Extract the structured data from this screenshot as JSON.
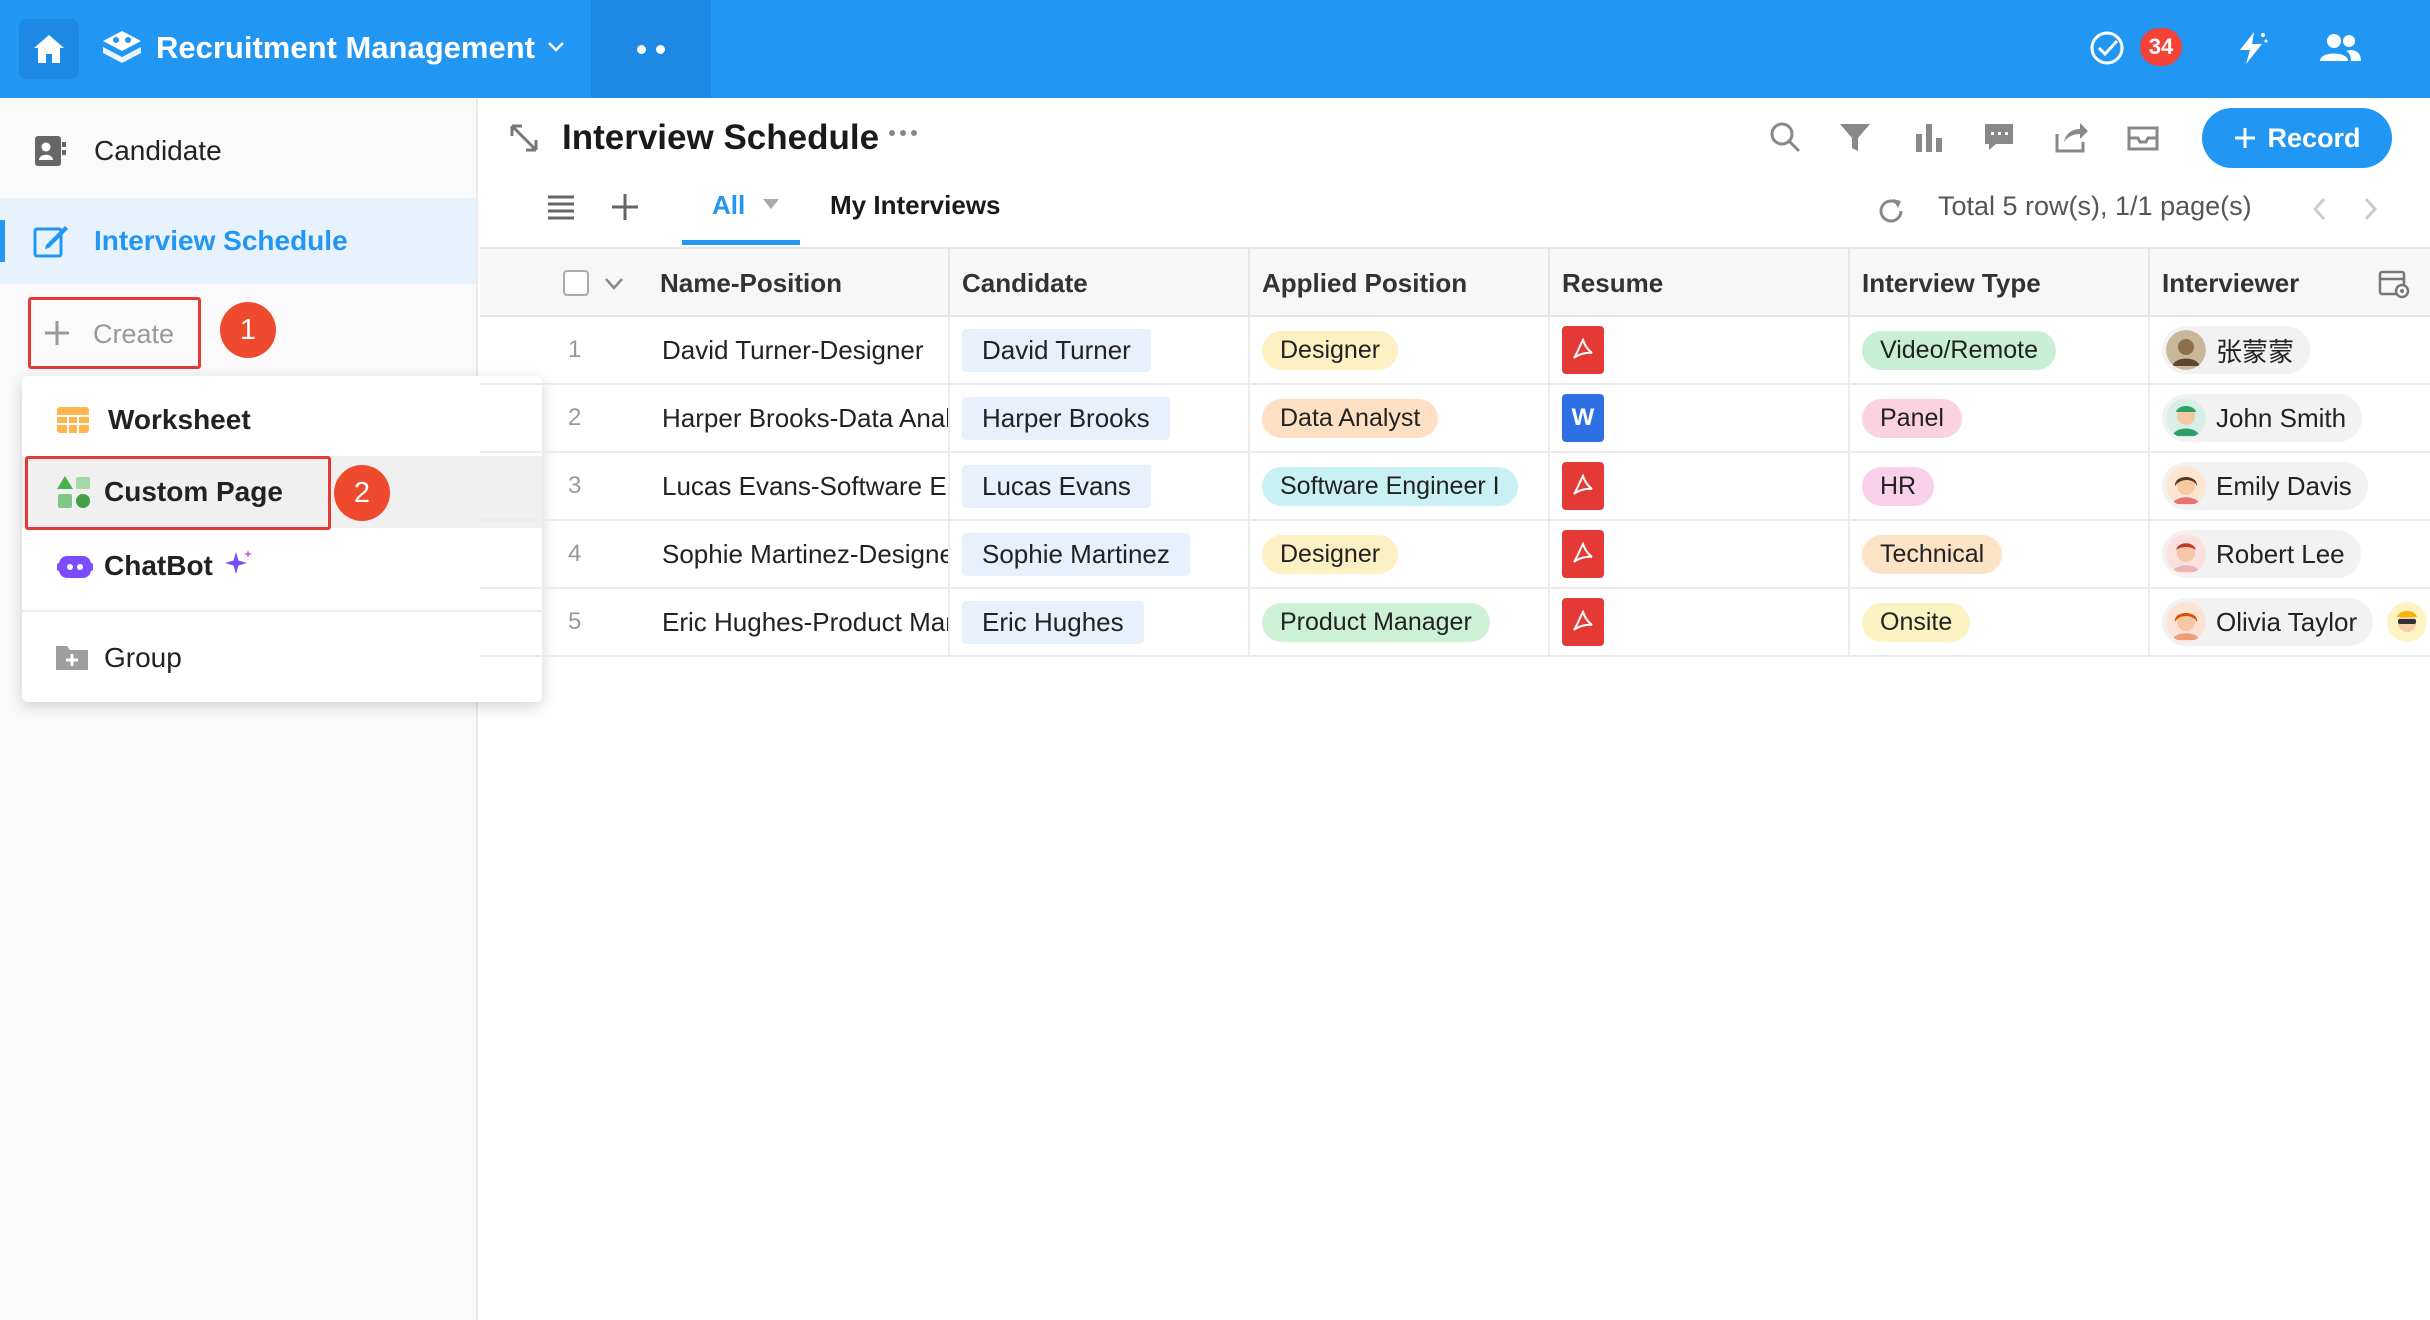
{
  "app": {
    "title": "Recruitment Management",
    "notification_count": "34"
  },
  "sidebar": {
    "items": [
      {
        "label": "Candidate",
        "icon": "contact-card-icon"
      },
      {
        "label": "Interview Schedule",
        "icon": "edit-icon"
      }
    ],
    "create_label": "Create",
    "step1": "1",
    "step2": "2"
  },
  "create_menu": {
    "items": [
      {
        "label": "Worksheet",
        "icon": "worksheet-icon"
      },
      {
        "label": "Custom Page",
        "icon": "custom-page-icon"
      },
      {
        "label": "ChatBot",
        "icon": "chatbot-icon"
      },
      {
        "label": "Group",
        "icon": "folder-add-icon"
      }
    ]
  },
  "view": {
    "title": "Interview Schedule",
    "record_button": "Record",
    "tabs": [
      {
        "label": "All"
      },
      {
        "label": "My Interviews"
      }
    ],
    "total": "Total 5 row(s), 1/1 page(s)"
  },
  "table": {
    "columns": [
      "Name-Position",
      "Candidate",
      "Applied Position",
      "Resume",
      "Interview Type",
      "Interviewer"
    ],
    "rows": [
      {
        "num": "1",
        "name_position": "David Turner-Designer",
        "candidate": "David Turner",
        "position": "Designer",
        "resume": "pdf",
        "type": "Video/Remote",
        "interviewer": "张蒙蒙"
      },
      {
        "num": "2",
        "name_position": "Harper Brooks-Data Analyst",
        "candidate": "Harper Brooks",
        "position": "Data Analyst",
        "resume": "word",
        "type": "Panel",
        "interviewer": "John Smith"
      },
      {
        "num": "3",
        "name_position": "Lucas Evans-Software Engineer",
        "candidate": "Lucas Evans",
        "position": "Software Engineer I",
        "resume": "pdf",
        "type": "HR",
        "interviewer": "Emily Davis"
      },
      {
        "num": "4",
        "name_position": "Sophie Martinez-Designer",
        "candidate": "Sophie Martinez",
        "position": "Designer",
        "resume": "pdf",
        "type": "Technical",
        "interviewer": "Robert Lee"
      },
      {
        "num": "5",
        "name_position": "Eric Hughes-Product Manager",
        "candidate": "Eric Hughes",
        "position": "Product Manager",
        "resume": "pdf",
        "type": "Onsite",
        "interviewer": "Olivia Taylor"
      }
    ]
  },
  "colors": {
    "accent": "#2196f3",
    "highlight_red": "#e53935",
    "tag_designer": "#fdf0c2",
    "tag_data_analyst": "#fde0c4",
    "tag_software": "#c9f0f2",
    "tag_product": "#cdf1d5",
    "tag_video": "#c8efd4",
    "tag_panel": "#fbd3df",
    "tag_hr": "#f8d0ea",
    "tag_technical": "#fde3c6",
    "tag_onsite": "#fbf3c2"
  }
}
